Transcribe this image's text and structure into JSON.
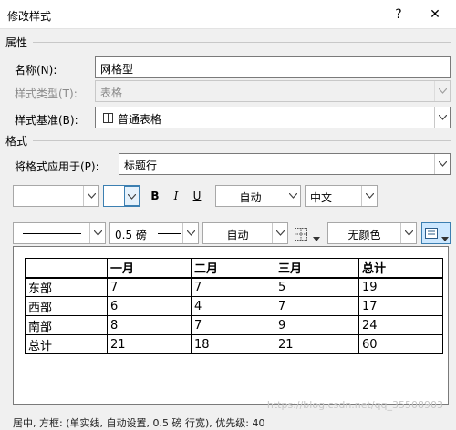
{
  "window": {
    "title": "修改样式",
    "help_label": "?",
    "close_label": "✕"
  },
  "properties": {
    "section_label": "属性",
    "name_label": "名称(N):",
    "name_value": "网格型",
    "type_label": "样式类型(T):",
    "type_value": "表格",
    "base_label": "样式基准(B):",
    "base_value": "普通表格",
    "base_icon": "table-grid-icon"
  },
  "format": {
    "section_label": "格式",
    "apply_label": "将格式应用于(P):",
    "apply_value": "标题行",
    "font_name": "",
    "font_size": "",
    "bold_label": "B",
    "italic_label": "I",
    "underline_label": "U",
    "font_color": "自动",
    "language": "中文",
    "border_weight": "0.5 磅",
    "border_color": "自动",
    "shading": "无颜色",
    "border_icon": "borders-icon",
    "alignment_icon": "cell-alignment-icon"
  },
  "preview": {
    "header": [
      "",
      "一月",
      "二月",
      "三月",
      "总计"
    ],
    "rows": [
      [
        "东部",
        "7",
        "7",
        "5",
        "19"
      ],
      [
        "西部",
        "6",
        "4",
        "7",
        "17"
      ],
      [
        "南部",
        "8",
        "7",
        "9",
        "24"
      ],
      [
        "总计",
        "21",
        "18",
        "21",
        "60"
      ]
    ]
  },
  "description": "居中, 方框: (单实线, 自动设置, 0.5 磅 行宽), 优先级: 40",
  "watermark": "https://blog.csdn.net/qq_35508903"
}
